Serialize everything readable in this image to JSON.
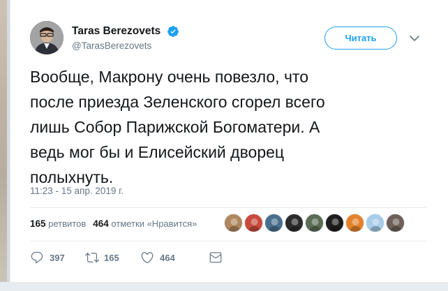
{
  "author": {
    "display_name": "Taras Berezovets",
    "handle": "@TarasBerezovets",
    "verified": true
  },
  "follow_button": {
    "label": "Читать"
  },
  "tweet": {
    "text": "Вообще, Макрону очень повезло, что\nпосле приезда Зеленского сгорел всего\nлишь Собор Парижской Богоматери. А\nведь мог бы и Елисейский дворец\nполыхнуть.",
    "timestamp": "11:23 - 15 апр. 2019 г."
  },
  "stats": {
    "retweets_count": "165",
    "retweets_label": "ретвитов",
    "likes_count": "464",
    "likes_label": "отметки «Нравится»"
  },
  "liker_avatars": [
    {
      "name": "liker-avatar-1",
      "color": "#b0865e"
    },
    {
      "name": "liker-avatar-2",
      "color": "#c84a3d"
    },
    {
      "name": "liker-avatar-3",
      "color": "#4a6f8e"
    },
    {
      "name": "liker-avatar-4",
      "color": "#2b2b2b"
    },
    {
      "name": "liker-avatar-5",
      "color": "#5b6d54"
    },
    {
      "name": "liker-avatar-6",
      "color": "#1e1e1e"
    },
    {
      "name": "liker-avatar-7",
      "color": "#e4822c"
    },
    {
      "name": "liker-avatar-8",
      "color": "#a8cde8"
    },
    {
      "name": "liker-avatar-9",
      "color": "#6e6058"
    }
  ],
  "actions": {
    "reply_count": "397",
    "retweet_count": "165",
    "like_count": "464"
  },
  "colors": {
    "accent": "#1da1f2",
    "text_primary": "#14171a",
    "text_secondary": "#657786",
    "divider": "#e6ecf0"
  }
}
